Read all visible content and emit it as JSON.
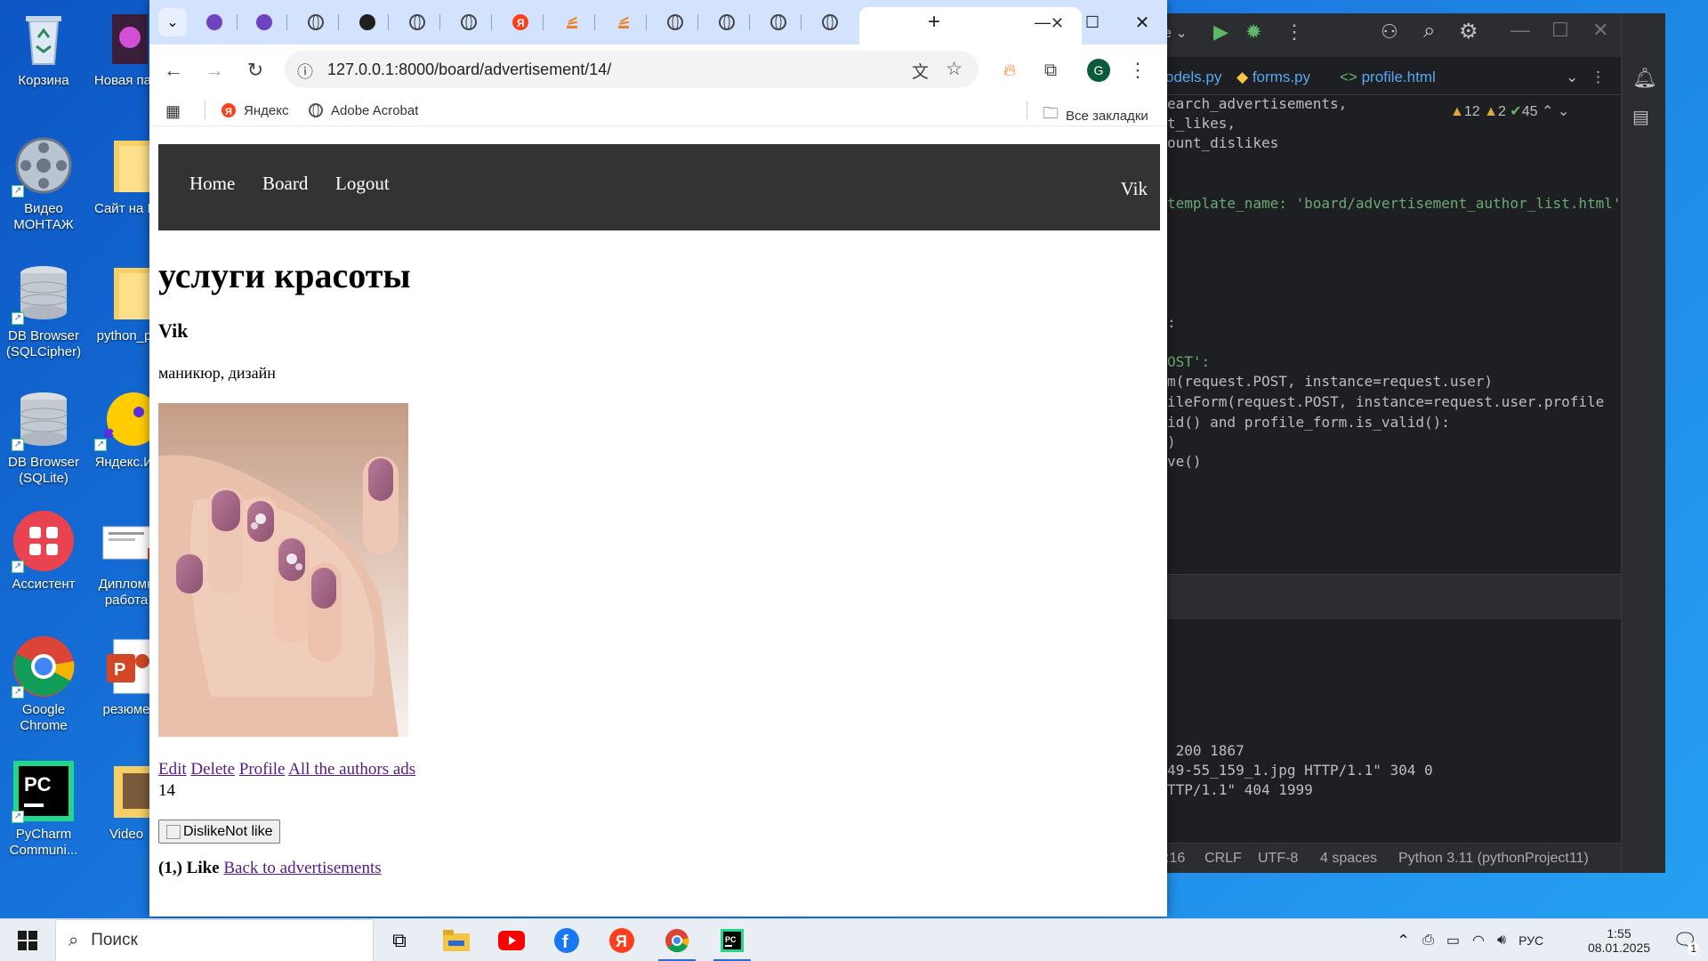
{
  "desktop": {
    "icons": [
      {
        "label": "Корзина"
      },
      {
        "label": "Новая пап"
      },
      {
        "label": "Видео МОНТАЖ"
      },
      {
        "label": "Сайт на Fl"
      },
      {
        "label": "DB Browser (SQLCipher)"
      },
      {
        "label": "python_pr"
      },
      {
        "label": "DB Browser (SQLite)"
      },
      {
        "label": "Яндекс.Иг"
      },
      {
        "label": "Ассистент"
      },
      {
        "label": "Дипломн работа"
      },
      {
        "label": "Google Chrome"
      },
      {
        "label": "резюме"
      },
      {
        "label": "PyCharm Communi..."
      },
      {
        "label": "Video"
      }
    ]
  },
  "ide": {
    "tabs": [
      "odels.py",
      "forms.py",
      "profile.html"
    ],
    "inspections": {
      "warnings": "12",
      "weak": "2",
      "ok": "45"
    },
    "code_lines": [
      "earch_advertisements,",
      "t_likes,",
      "ount_dislikes",
      "",
      "template_name: 'board/advertisement_author_list.html'",
      ":",
      "OST':",
      "m(request.POST, instance=request.user)",
      "ileForm(request.POST, instance=request.user.profile",
      "id() and profile_form.is_valid():",
      ")",
      "ve()"
    ],
    "terminal_lines": [
      " 200 1867",
      "49-55_159_1.jpg HTTP/1.1\" 304 0",
      "TTP/1.1\" 404 1999"
    ],
    "status": {
      "pos": ":16",
      "eol": "CRLF",
      "encoding": "UTF-8",
      "indent": "4 spaces",
      "interpreter": "Python 3.11 (pythonProject11)"
    }
  },
  "browser": {
    "url": "127.0.0.1:8000/board/advertisement/14/",
    "profile_initial": "G",
    "bookmarks": [
      "Яндекс",
      "Adobe Acrobat"
    ],
    "all_bookmarks": "Все закладки"
  },
  "page": {
    "nav": {
      "home": "Home",
      "board": "Board",
      "logout": "Logout",
      "user": "Vik"
    },
    "title": "услуги красоты",
    "author": "Vik",
    "description": "маникюр, дизайн",
    "actions": {
      "edit": "Edit",
      "delete": "Delete",
      "profile": "Profile",
      "authors_ads": "All the authors ads"
    },
    "count": "14",
    "dislike_button": "DislikeNot like",
    "likes_text": "(1,) Like",
    "back_link": "Back to advertisements"
  },
  "taskbar": {
    "search_placeholder": "Поиск",
    "lang": "РУС",
    "time": "1:55",
    "date": "08.01.2025",
    "notifications": "1"
  },
  "colors": {
    "navbar": "#333333",
    "link_visited": "#551a8b",
    "chrome_tabstrip": "#d3e3fd"
  }
}
